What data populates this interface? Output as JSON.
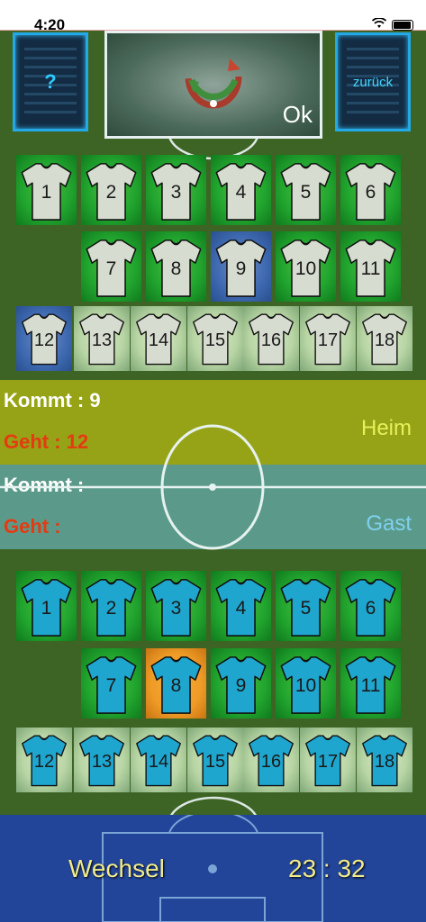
{
  "status": {
    "time": "4:20"
  },
  "top": {
    "help_label": "?",
    "back_label": "zurück",
    "ok_label": "Ok"
  },
  "home_team": {
    "color": "#d7dcd0",
    "row1": [
      "1",
      "2",
      "3",
      "4",
      "5",
      "6"
    ],
    "row2": [
      "7",
      "8",
      "9",
      "10",
      "11"
    ],
    "bench": [
      "12",
      "13",
      "14",
      "15",
      "16",
      "17",
      "18"
    ],
    "selected_field": "9",
    "selected_bench": "12"
  },
  "info": {
    "heim": {
      "kommt": "Kommt : 9",
      "geht": "Geht  : 12",
      "label": "Heim"
    },
    "gast": {
      "kommt": "Kommt :",
      "geht": "Geht  :",
      "label": "Gast"
    }
  },
  "away_team": {
    "color": "#1ea6cf",
    "row1": [
      "1",
      "2",
      "3",
      "4",
      "5",
      "6"
    ],
    "row2": [
      "7",
      "8",
      "9",
      "10",
      "11"
    ],
    "bench": [
      "12",
      "13",
      "14",
      "15",
      "16",
      "17",
      "18"
    ],
    "selected_field": "8"
  },
  "bottom": {
    "title": "Wechsel",
    "timer": "23 : 32"
  }
}
